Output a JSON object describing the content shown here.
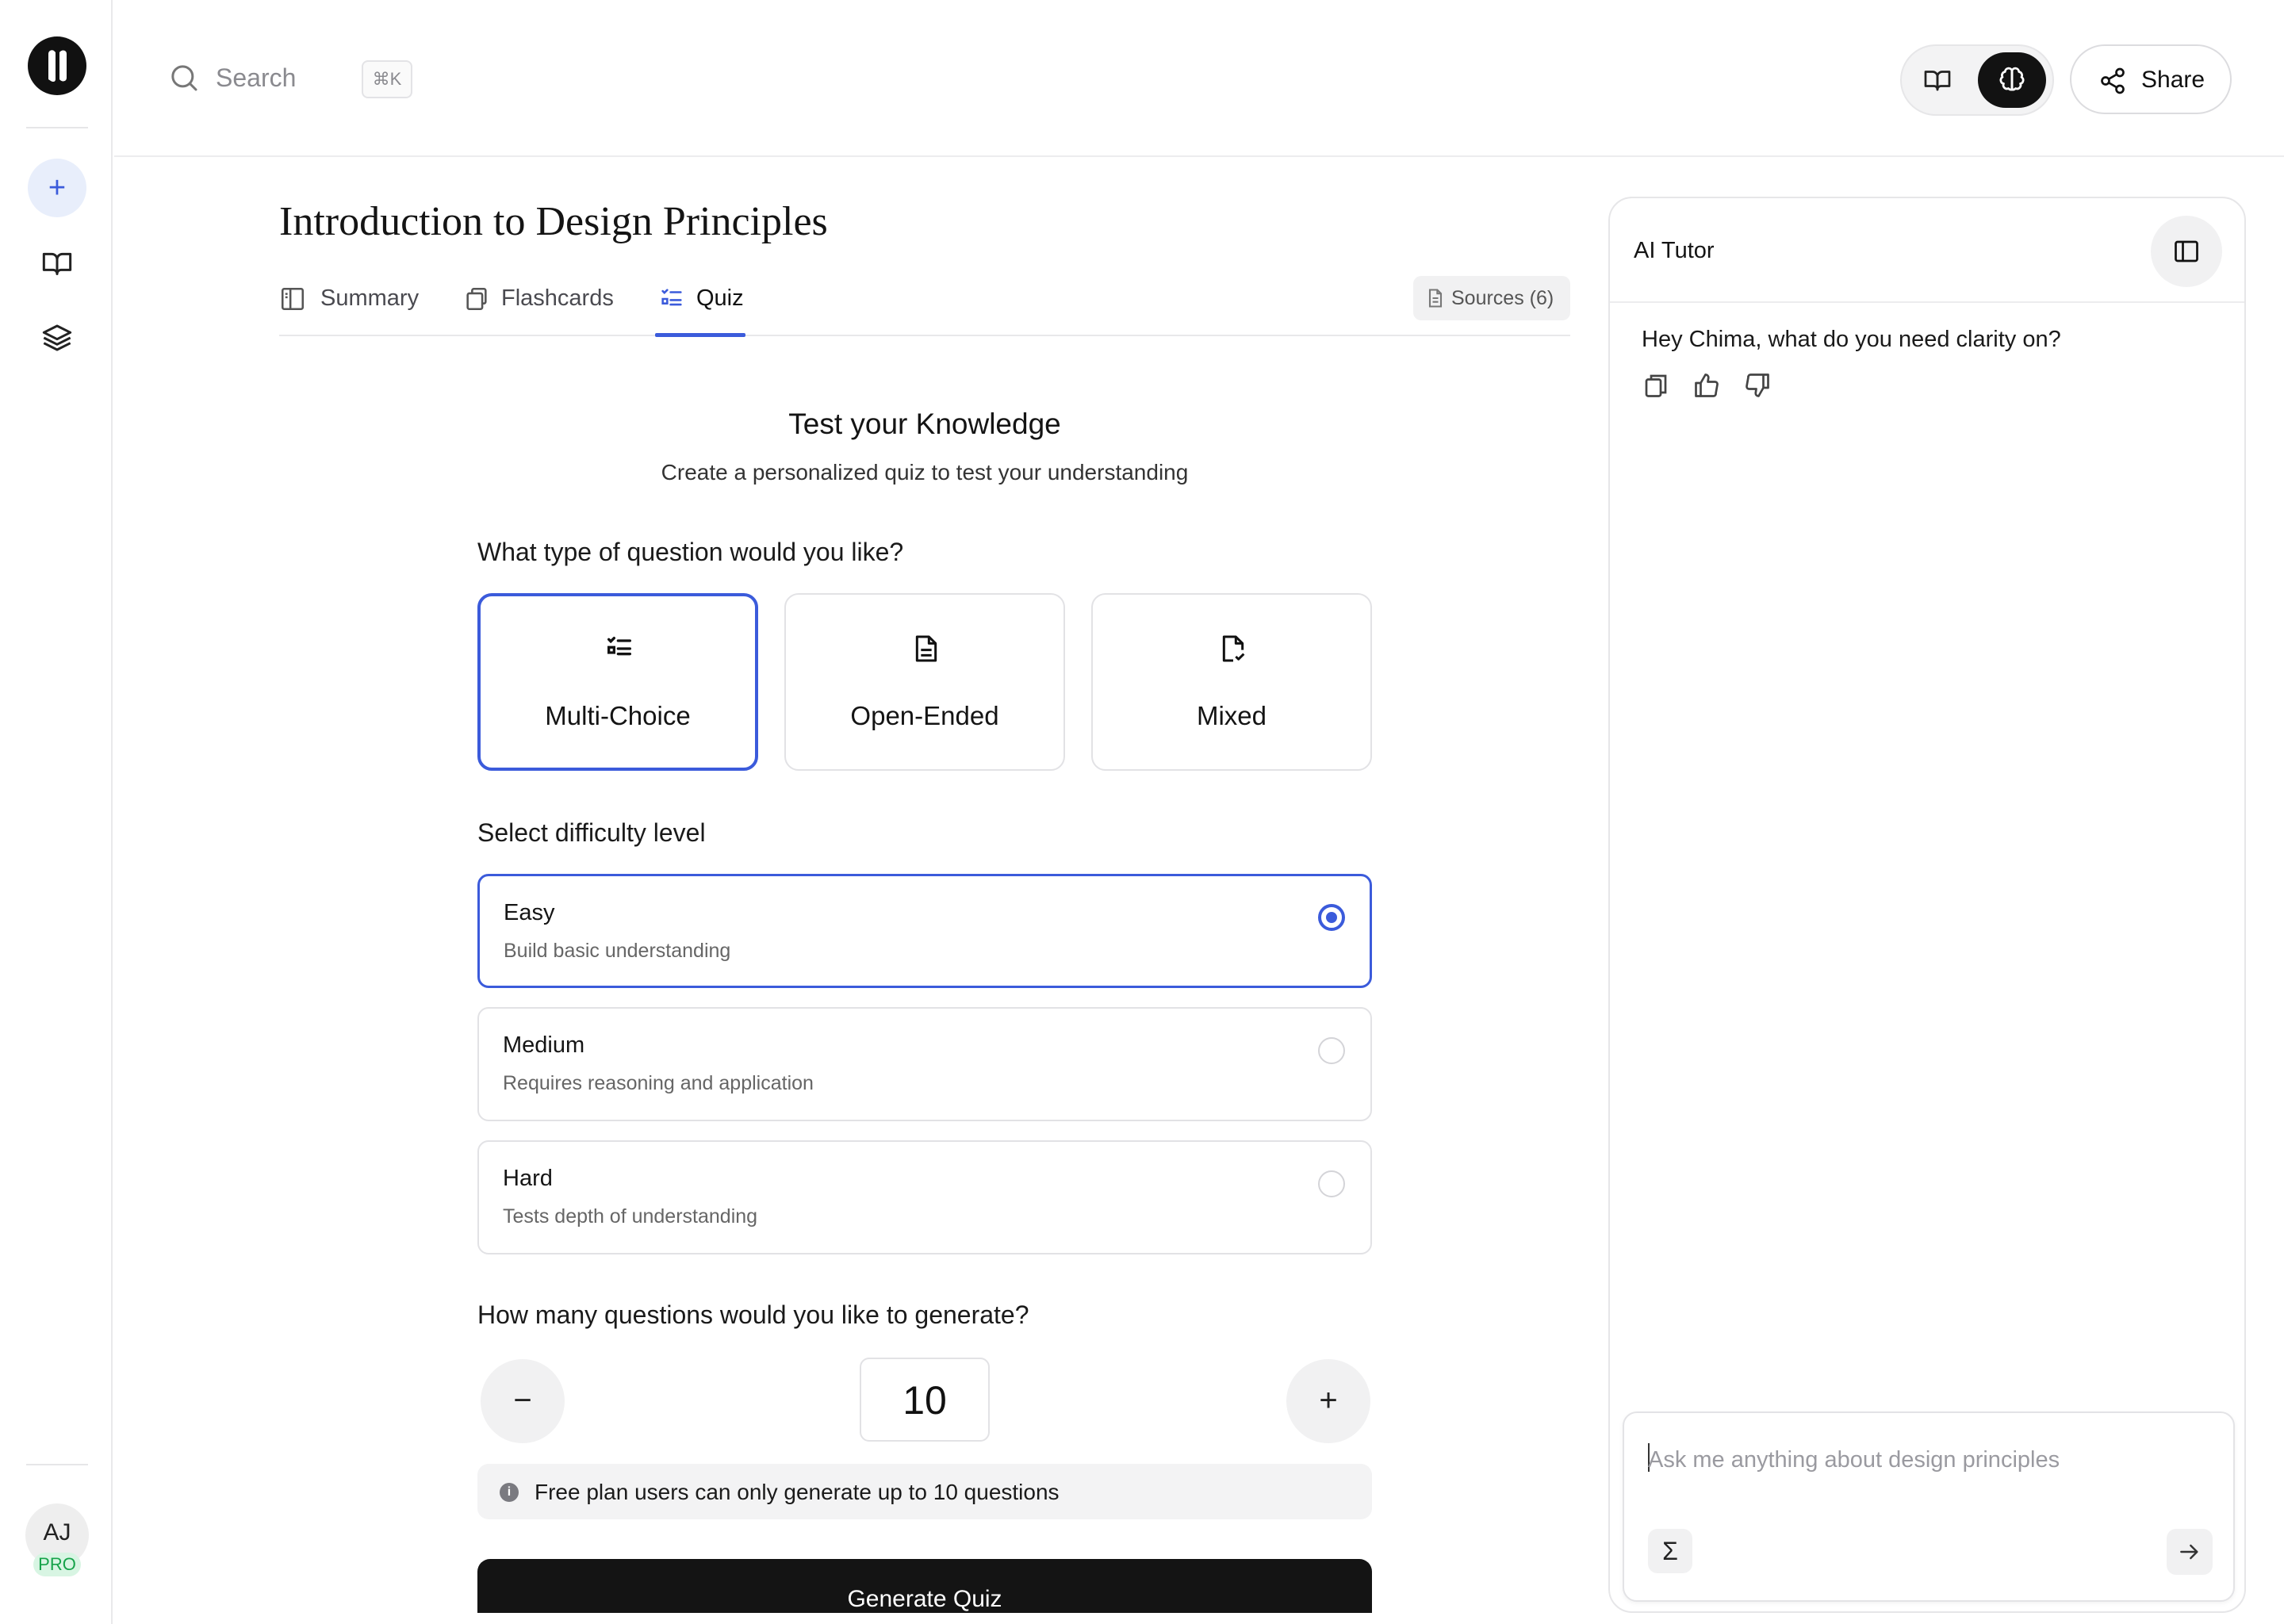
{
  "search": {
    "placeholder": "Search",
    "shortcut": "⌘K"
  },
  "header": {
    "share_label": "Share"
  },
  "user": {
    "initials": "AJ",
    "plan_badge": "PRO"
  },
  "page": {
    "title": "Introduction to Design Principles"
  },
  "tabs": [
    {
      "label": "Summary",
      "active": false
    },
    {
      "label": "Flashcards",
      "active": false
    },
    {
      "label": "Quiz",
      "active": true
    }
  ],
  "sources_label": "Sources (6)",
  "quiz": {
    "heading": "Test your Knowledge",
    "subheading": "Create a personalized quiz to test your understanding",
    "question_type_prompt": "What type of question would you like?",
    "question_types": [
      {
        "label": "Multi-Choice",
        "icon": "list-check-icon",
        "selected": true
      },
      {
        "label": "Open-Ended",
        "icon": "document-icon",
        "selected": false
      },
      {
        "label": "Mixed",
        "icon": "file-check-icon",
        "selected": false
      }
    ],
    "difficulty_prompt": "Select difficulty level",
    "difficulties": [
      {
        "title": "Easy",
        "description": "Build basic understanding",
        "selected": true
      },
      {
        "title": "Medium",
        "description": "Requires reasoning and application",
        "selected": false
      },
      {
        "title": "Hard",
        "description": "Tests depth of understanding",
        "selected": false
      }
    ],
    "count_prompt": "How many questions would you like to generate?",
    "count": "10",
    "decrement": "−",
    "increment": "+",
    "notice": "Free plan users can only generate up to 10 questions",
    "notice_icon": "i",
    "generate_label": "Generate Quiz"
  },
  "tutor": {
    "title": "AI Tutor",
    "greeting": "Hey Chima, what do you need clarity on?",
    "input_placeholder": "Ask me anything about design principles",
    "math_tool": "Σ"
  },
  "rail": {
    "new_label": "+"
  },
  "colors": {
    "accent": "#3b5bdb",
    "dark": "#141414",
    "success": "#16a34a"
  }
}
